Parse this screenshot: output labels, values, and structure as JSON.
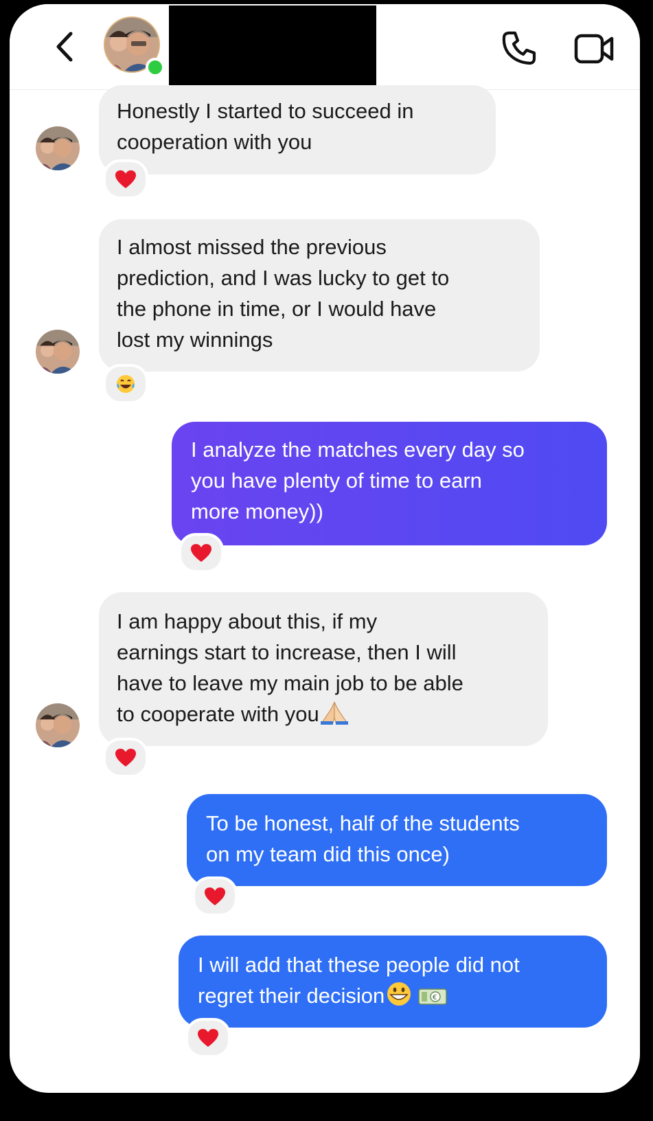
{
  "header": {
    "back_icon": "chevron-left-icon",
    "call_icon": "phone-icon",
    "video_icon": "video-camera-icon"
  },
  "messages": [
    {
      "side": "incoming",
      "lines": [
        "Honestly I started to succeed in",
        "cooperation with you"
      ],
      "reaction": "heart"
    },
    {
      "side": "incoming",
      "lines": [
        "I almost missed the previous",
        "prediction, and I was lucky to get to",
        "the phone in time, or I would have",
        "lost my winnings"
      ],
      "reaction": "laughing-tears"
    },
    {
      "side": "outgoing",
      "lines": [
        "I analyze the matches every day so",
        "you have plenty of time to earn",
        "more money))"
      ],
      "reaction": "heart"
    },
    {
      "side": "incoming",
      "lines": [
        "I am happy about this, if my",
        "earnings start to increase, then I will",
        "have to leave my main job to be able",
        "to cooperate with you"
      ],
      "trailing_emoji": "folded-hands",
      "reaction": "heart"
    },
    {
      "side": "outgoing",
      "lines": [
        "To be honest, half of the students",
        "on my team did this once)"
      ],
      "reaction": "heart"
    },
    {
      "side": "outgoing",
      "lines": [
        "I will add that these people did not",
        "regret their decision"
      ],
      "trailing_emoji": [
        "grinning-face",
        "euro-banknote"
      ],
      "reaction": "heart"
    }
  ],
  "colors": {
    "incoming_bubble": "#efefef",
    "outgoing_purple": "#5a45f0",
    "outgoing_blue": "#2f6ff5",
    "heart": "#e8192c",
    "online": "#2ecc40"
  }
}
